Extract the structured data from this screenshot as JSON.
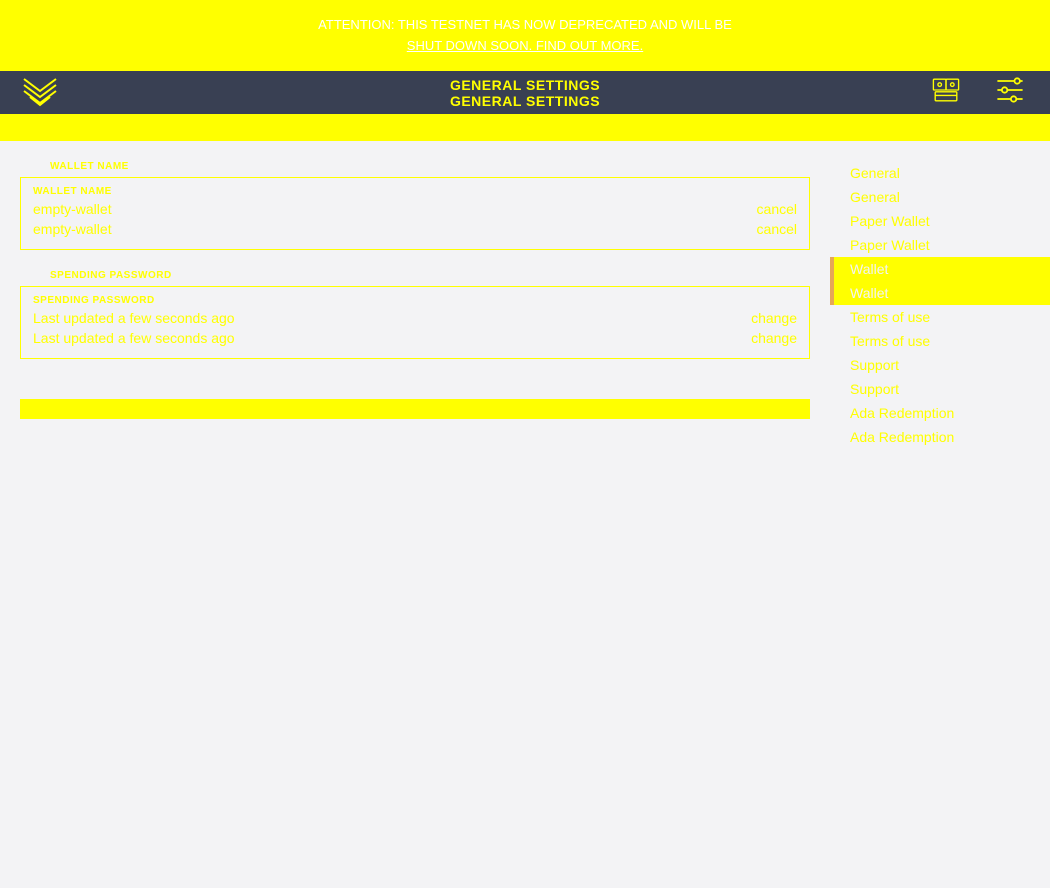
{
  "banner": {
    "line1": "ATTENTION: THIS TESTNET HAS NOW DEPRECATED AND WILL BE",
    "line2": "SHUT DOWN SOON. FIND OUT MORE."
  },
  "topbar": {
    "title1": "GENERAL SETTINGS",
    "title2": "GENERAL SETTINGS"
  },
  "main": {
    "walletName": {
      "labelOuter": "WALLET NAME",
      "labelInner": "WALLET NAME",
      "value1": "empty-wallet",
      "action1": "cancel",
      "value2": "empty-wallet",
      "action2": "cancel"
    },
    "spendingPassword": {
      "labelOuter": "SPENDING PASSWORD",
      "labelInner": "SPENDING PASSWORD",
      "value1": "Last updated a few seconds ago",
      "action1": "change",
      "value2": "Last updated a few seconds ago",
      "action2": "change"
    }
  },
  "sidebar": {
    "items": [
      {
        "label": "General",
        "active": false
      },
      {
        "label": "General",
        "active": false
      },
      {
        "label": "Paper Wallet",
        "active": false
      },
      {
        "label": "Paper Wallet",
        "active": false
      },
      {
        "label": "Wallet",
        "active": true
      },
      {
        "label": "Wallet",
        "active": true
      },
      {
        "label": "Terms of use",
        "active": false
      },
      {
        "label": "Terms of use",
        "active": false
      },
      {
        "label": "Support",
        "active": false
      },
      {
        "label": "Support",
        "active": false
      },
      {
        "label": "Ada Redemption",
        "active": false
      },
      {
        "label": "Ada Redemption",
        "active": false
      }
    ]
  }
}
